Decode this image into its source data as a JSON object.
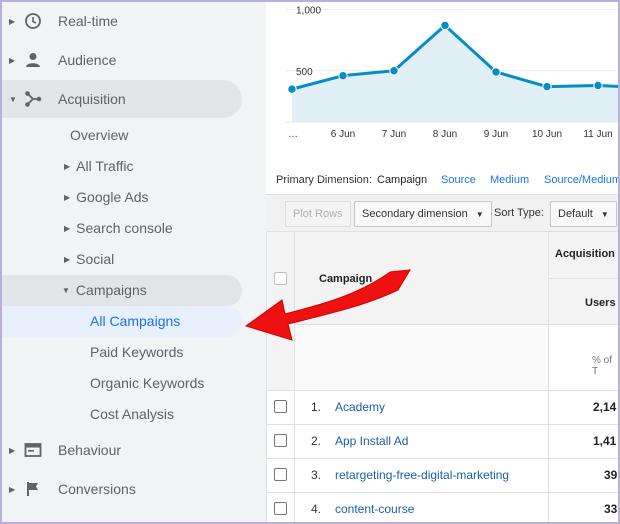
{
  "sidebar": {
    "top_items": [
      {
        "label": "Real-time",
        "icon": "clock-icon"
      },
      {
        "label": "Audience",
        "icon": "person-icon"
      },
      {
        "label": "Acquisition",
        "icon": "acquisition-icon"
      },
      {
        "label": "Behaviour",
        "icon": "window-icon"
      },
      {
        "label": "Conversions",
        "icon": "flag-icon"
      }
    ],
    "acquisition_children": {
      "overview": "Overview",
      "all_traffic": "All Traffic",
      "google_ads": "Google Ads",
      "search_console": "Search console",
      "social": "Social",
      "campaigns": "Campaigns"
    },
    "campaigns_children": [
      "All Campaigns",
      "Paid Keywords",
      "Organic Keywords",
      "Cost Analysis"
    ],
    "selected": "All Campaigns"
  },
  "chart_data": {
    "type": "area",
    "x": [
      "…",
      "6 Jun",
      "7 Jun",
      "8 Jun",
      "9 Jun",
      "10 Jun",
      "11 Jun",
      ""
    ],
    "series": [
      {
        "values": [
          350,
          460,
          500,
          870,
          490,
          370,
          380,
          360
        ]
      }
    ],
    "y_tick_labels": [
      "1,000",
      "500"
    ],
    "y_ticks": [
      1000,
      500
    ],
    "ylim": [
      0,
      1100
    ],
    "line_color": "#058dc7",
    "fill_color": "#e1eff7"
  },
  "dimension_bar": {
    "label": "Primary Dimension:",
    "current": "Campaign",
    "links": [
      "Source",
      "Medium",
      "Source/Medium"
    ]
  },
  "toolbar": {
    "plot_rows": "Plot Rows",
    "secondary_dimension": "Secondary dimension",
    "sort_type_label": "Sort Type:",
    "sort_type_value": "Default"
  },
  "table": {
    "campaign_header": "Campaign",
    "acquisition_header": "Acquisition",
    "users_header": "Users",
    "summary_pct": "% of T",
    "rows": [
      {
        "num": "1.",
        "name": "Academy",
        "users": "2,14"
      },
      {
        "num": "2.",
        "name": "App Install Ad",
        "users": "1,41"
      },
      {
        "num": "3.",
        "name": "retargeting-free-digital-marketing",
        "users": "39"
      },
      {
        "num": "4.",
        "name": "content-course",
        "users": "33"
      }
    ]
  },
  "colors": {
    "arrow": "#ee1111",
    "link": "#1a73e8",
    "sidebar_bg": "#f1f3f4",
    "selected_bg": "#e8f0fe"
  }
}
